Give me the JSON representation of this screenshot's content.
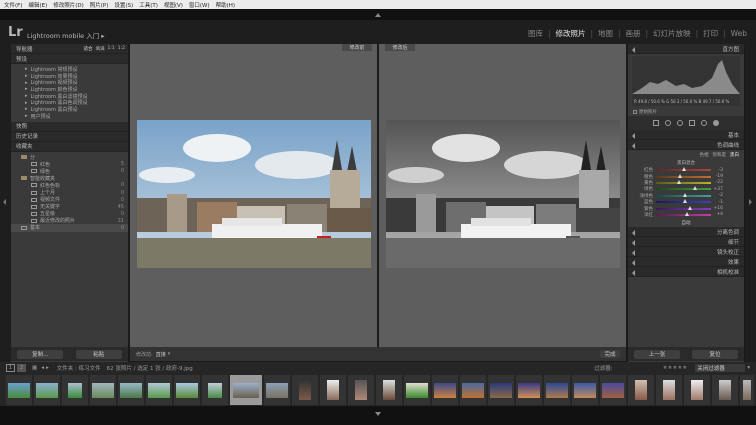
{
  "menubar": {
    "items": [
      "文件(F)",
      "编辑(E)",
      "修改照片(D)",
      "照片(P)",
      "设置(S)",
      "工具(T)",
      "视图(V)",
      "窗口(W)",
      "帮助(H)"
    ]
  },
  "topbar": {
    "logo": "Lr",
    "app_name": "Lightroom mobile 入门",
    "app_arrow": "▸"
  },
  "modules": [
    {
      "label": "图库",
      "active": false
    },
    {
      "label": "修改照片",
      "active": true
    },
    {
      "label": "地图",
      "active": false
    },
    {
      "label": "画册",
      "active": false
    },
    {
      "label": "幻灯片放映",
      "active": false
    },
    {
      "label": "打印",
      "active": false
    },
    {
      "label": "Web",
      "active": false
    }
  ],
  "left_panel": {
    "navigator": {
      "title": "导航器",
      "zoom_options": [
        "适合",
        "填满",
        "1:1",
        "1:2"
      ]
    },
    "presets": {
      "title": "预设",
      "items": [
        "Lightroom 常规预设",
        "Lightroom 效果预设",
        "Lightroom 视频预设",
        "Lightroom 颜色预设",
        "Lightroom 黑白滤镜预设",
        "Lightroom 黑白色调预设",
        "Lightroom 黑白预设",
        "用户预设"
      ]
    },
    "snapshots": {
      "title": "快照"
    },
    "history": {
      "title": "历史记录"
    },
    "collections": {
      "title": "收藏夹",
      "items": [
        {
          "label": "分",
          "count": ""
        },
        {
          "label": "红色",
          "count": "5"
        },
        {
          "label": "绿色",
          "count": "0"
        },
        {
          "label": "智能收藏夹",
          "count": ""
        },
        {
          "label": "红色色标",
          "count": "0"
        },
        {
          "label": "上个月",
          "count": "0"
        },
        {
          "label": "视频文件",
          "count": "0"
        },
        {
          "label": "无关键字",
          "count": "45"
        },
        {
          "label": "五星级",
          "count": "0"
        },
        {
          "label": "最近修改的照片",
          "count": "31"
        },
        {
          "label": "基本",
          "count": "0"
        }
      ]
    },
    "copy_button": "复制...",
    "paste_button": "粘贴"
  },
  "center": {
    "before_label": "修改前",
    "after_label": "修改后",
    "toolbar_label": "修改前:",
    "toolbar_value": "直接",
    "done_button": "完成"
  },
  "right_panel": {
    "histogram": {
      "title": "直方图",
      "readout": "R 49.8 / 50.6 % G 50.3 / 50.6 % B 49.7 / 50.6 %",
      "original_checkbox": "原始照片"
    },
    "basic": {
      "title": "基本"
    },
    "tone_curve": {
      "title": "色调曲线"
    },
    "hsl": {
      "tabs": [
        "色相",
        "饱和度",
        "黑白"
      ],
      "active_tab": "黑白"
    },
    "bw_mix": {
      "title": "黑白混合",
      "sliders": [
        {
          "label": "红色",
          "value": "-3"
        },
        {
          "label": "橙色",
          "value": "-19"
        },
        {
          "label": "黄色",
          "value": "-22"
        },
        {
          "label": "绿色",
          "value": "+37"
        },
        {
          "label": "浅绿色",
          "value": "-2"
        },
        {
          "label": "蓝色",
          "value": "-1"
        },
        {
          "label": "紫色",
          "value": "+16"
        },
        {
          "label": "洋红",
          "value": "+4"
        }
      ],
      "auto_label": "自动"
    },
    "split_toning": {
      "title": "分离色调"
    },
    "detail": {
      "title": "细节"
    },
    "lens": {
      "title": "镜头校正"
    },
    "effects": {
      "title": "效果"
    },
    "camera": {
      "title": "相机校准"
    },
    "prev_button": "上一张",
    "reset_button": "复位"
  },
  "filmstrip": {
    "page_indicator": "1",
    "page_indicator2": "2",
    "path": "文件夹 : 练习文件",
    "count": "62 张照片 / 选定 1 张 / 政府-9.jpg",
    "filter_label": "过滤器:",
    "filter_value": "关闭过滤器",
    "thumbnail_count": 27,
    "selected_index": 8
  },
  "colors": {
    "accent": "#e6e6e6",
    "panel": "#3a3a3a",
    "dark": "#262626"
  }
}
